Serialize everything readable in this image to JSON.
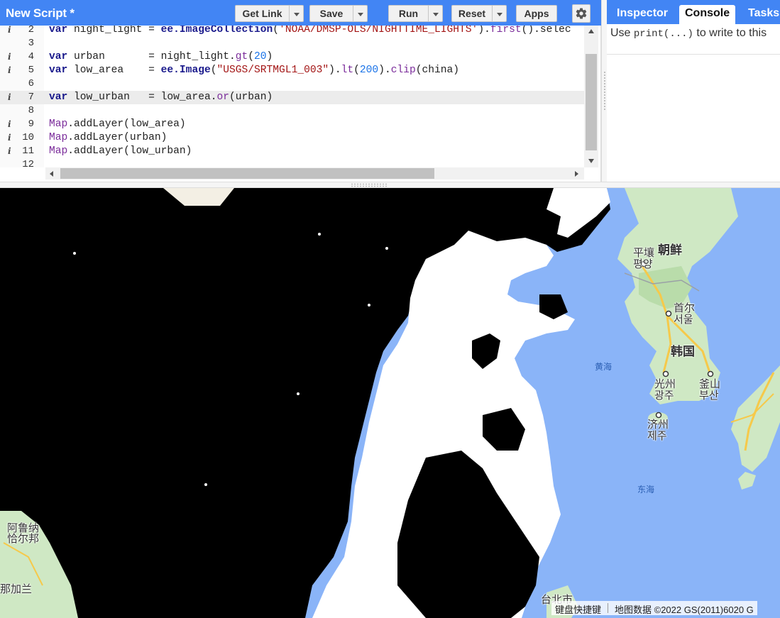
{
  "toolbar": {
    "script_title": "New Script *",
    "get_link_label": "Get Link",
    "save_label": "Save",
    "run_label": "Run",
    "reset_label": "Reset",
    "apps_label": "Apps",
    "settings_icon": "gear-icon"
  },
  "code": {
    "lines": [
      {
        "number": "2",
        "has_info": true,
        "text": "var night_light = ee.ImageCollection('NOAA/DMSP-OLS/NIGHTTIME_LIGHTS').first().selec"
      },
      {
        "number": "3",
        "has_info": false,
        "text": ""
      },
      {
        "number": "4",
        "has_info": true,
        "text": "var urban       = night_light.gt(20)"
      },
      {
        "number": "5",
        "has_info": true,
        "text": "var low_area    = ee.Image(\"USGS/SRTMGL1_003\").lt(200).clip(china)"
      },
      {
        "number": "6",
        "has_info": false,
        "text": ""
      },
      {
        "number": "7",
        "has_info": true,
        "text": "var low_urban   = low_area.or(urban)"
      },
      {
        "number": "8",
        "has_info": false,
        "text": ""
      },
      {
        "number": "9",
        "has_info": true,
        "text": "Map.addLayer(low_area)"
      },
      {
        "number": "10",
        "has_info": true,
        "text": "Map.addLayer(urban)"
      },
      {
        "number": "11",
        "has_info": true,
        "text": "Map.addLayer(low_urban)"
      },
      {
        "number": "12",
        "has_info": false,
        "text": ""
      }
    ],
    "active_line": "7"
  },
  "right_panel": {
    "tabs": [
      "Inspector",
      "Console",
      "Tasks"
    ],
    "selected_tab": "Console",
    "console_message_prefix": "Use ",
    "console_message_code": "print(...)",
    "console_message_suffix": " to write to this"
  },
  "map": {
    "labels": {
      "north_korea": "朝鲜",
      "pyongyang_zh": "平壤",
      "pyongyang_ko": "평양",
      "seoul_zh": "首尔",
      "seoul_ko": "서울",
      "south_korea": "韩国",
      "yellow_sea": "黄海",
      "gwangju_zh": "光州",
      "gwangju_ko": "광주",
      "busan_zh": "釜山",
      "busan_ko": "부산",
      "jeju_zh": "济州",
      "jeju_ko": "제주",
      "east_china_sea": "东海",
      "arunachal_1": "阿鲁纳",
      "arunachal_2": "恰尔邦",
      "nagaland": "那加兰",
      "taipei": "台北市"
    },
    "attribution": {
      "keyboard_shortcuts": "键盘快捷键",
      "map_data": "地图数据 ©2022 GS(2011)6020 G"
    },
    "colors": {
      "water": "#8ab4f8",
      "land": "#e8f0e4",
      "mask_dark": "#000000",
      "mask_light": "#ffffff",
      "accent": "#4285f4"
    }
  }
}
